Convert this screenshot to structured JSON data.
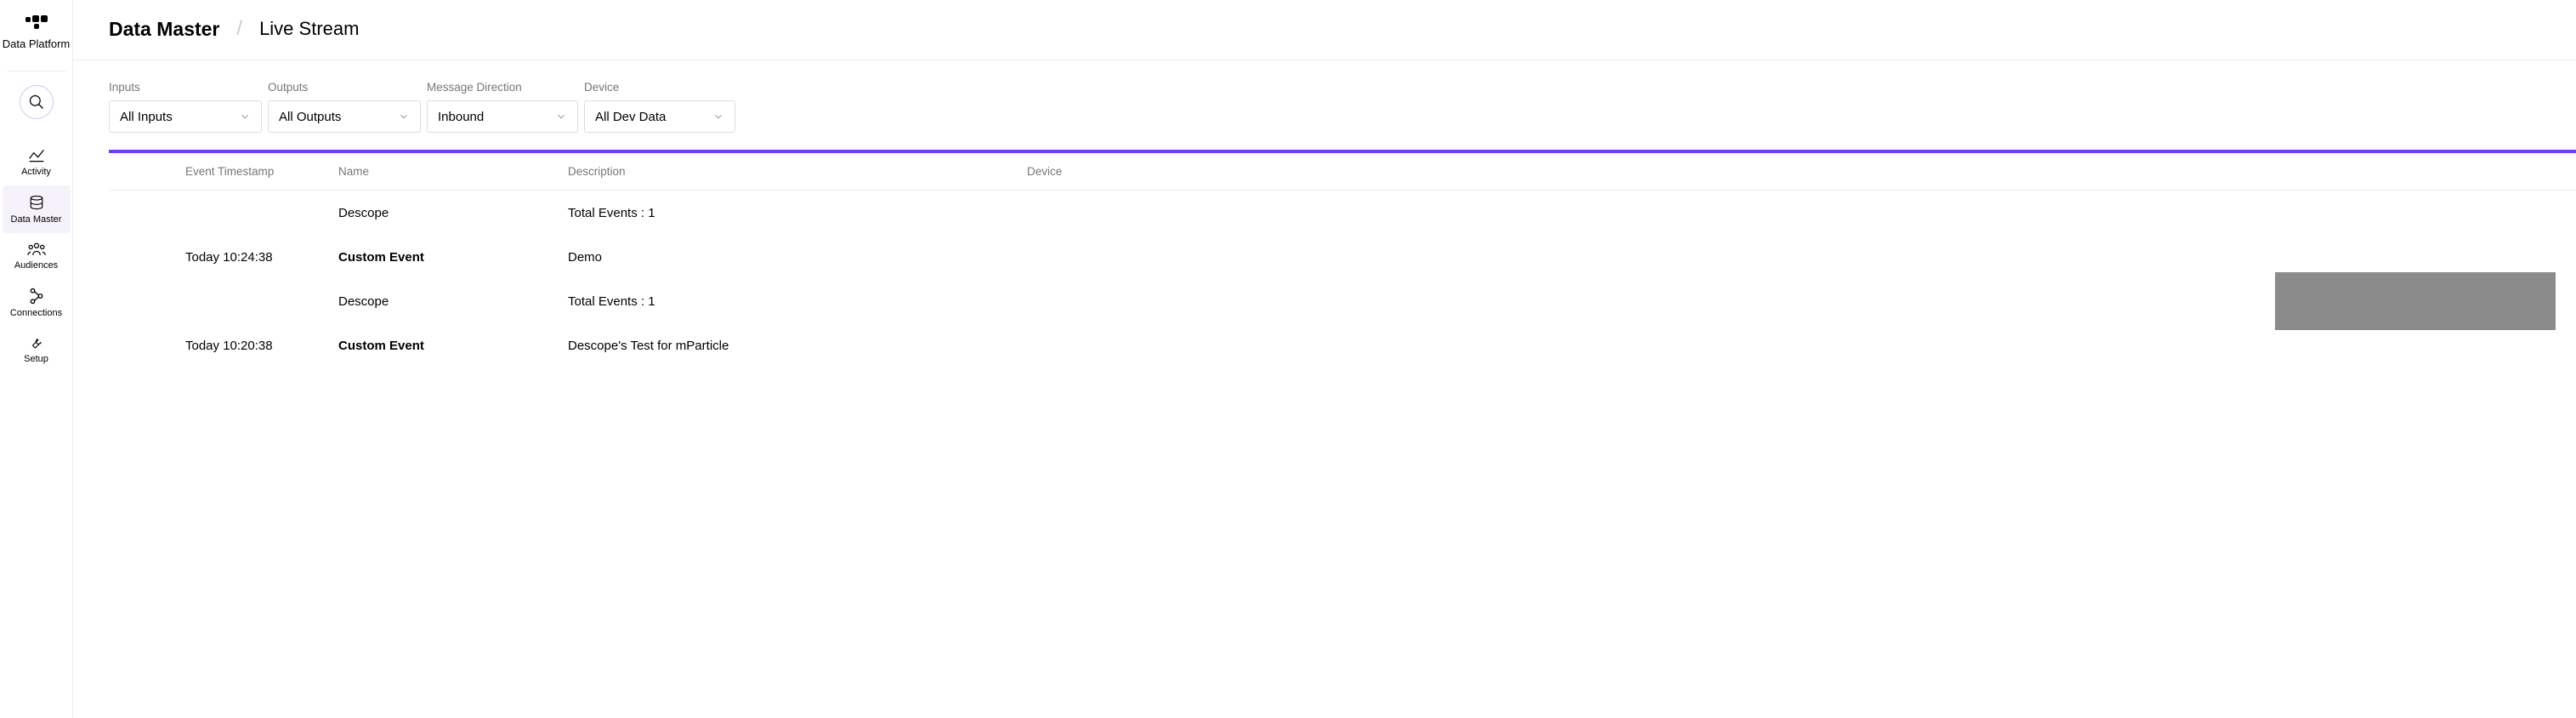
{
  "brand": "Data Platform",
  "nav": {
    "activity": "Activity",
    "data_master": "Data Master",
    "audiences": "Audiences",
    "connections": "Connections",
    "setup": "Setup"
  },
  "breadcrumb": {
    "root": "Data Master",
    "page": "Live Stream"
  },
  "filters": {
    "inputs": {
      "label": "Inputs",
      "value": "All Inputs"
    },
    "outputs": {
      "label": "Outputs",
      "value": "All Outputs"
    },
    "direction": {
      "label": "Message Direction",
      "value": "Inbound"
    },
    "device": {
      "label": "Device",
      "value": "All Dev Data"
    }
  },
  "columns": {
    "ts": "Event Timestamp",
    "name": "Name",
    "desc": "Description",
    "device": "Device"
  },
  "rows": [
    {
      "ts": "",
      "name": "Descope",
      "desc": "Total Events : 1",
      "bold": false
    },
    {
      "ts": "Today 10:24:38",
      "name": "Custom Event",
      "desc": "Demo",
      "bold": true
    },
    {
      "ts": "",
      "name": "Descope",
      "desc": "Total Events : 1",
      "bold": false
    },
    {
      "ts": "Today 10:20:38",
      "name": "Custom Event",
      "desc": "Descope's Test for mParticle",
      "bold": true
    }
  ]
}
